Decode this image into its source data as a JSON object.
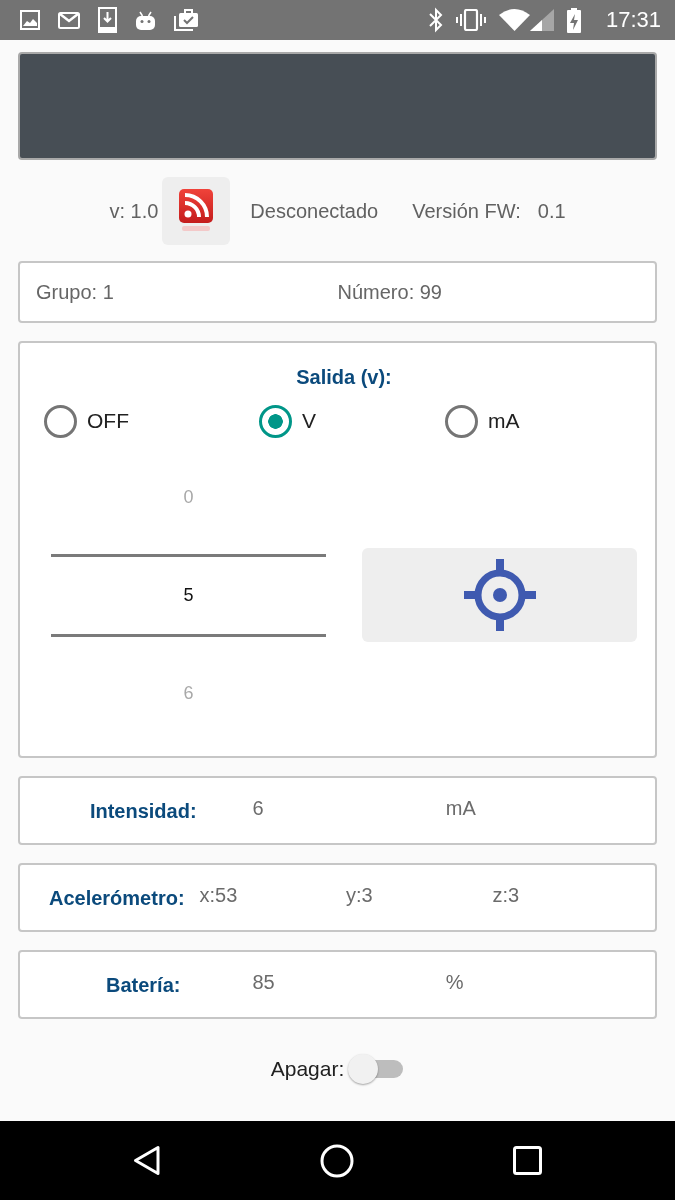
{
  "status_bar": {
    "time": "17:31"
  },
  "connection": {
    "app_version": "v: 1.0",
    "status": "Desconectado",
    "firmware_label": "Versión FW:",
    "firmware_version": "0.1"
  },
  "device": {
    "group": "Grupo: 1",
    "number": "Número: 99"
  },
  "output": {
    "title": "Salida (v):",
    "modes": [
      {
        "label": "OFF",
        "selected": false
      },
      {
        "label": "V",
        "selected": true
      },
      {
        "label": "mA",
        "selected": false
      }
    ],
    "picker": [
      {
        "value": "0",
        "selected": false
      },
      {
        "value": "5",
        "selected": true
      },
      {
        "value": "6",
        "selected": false
      }
    ]
  },
  "readings": [
    {
      "label": "Intensidad:",
      "values": [
        "6",
        "mA"
      ]
    },
    {
      "label": "Acelerómetro:",
      "values": [
        "x:53",
        "y:3",
        "z:3"
      ]
    },
    {
      "label": "Batería:",
      "values": [
        "85",
        "%"
      ]
    }
  ],
  "shutdown": {
    "label": "Apagar:",
    "on": false
  }
}
